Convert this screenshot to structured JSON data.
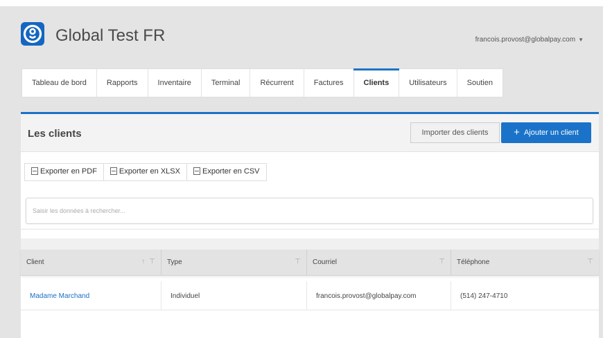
{
  "app": {
    "title": "Global Test FR",
    "user_email": "francois.provost@globalpay.com"
  },
  "colors": {
    "accent": "#1a73c8",
    "logo": "#1566c0",
    "link": "#1a6fc4"
  },
  "tabs": [
    {
      "label": "Tableau de bord"
    },
    {
      "label": "Rapports"
    },
    {
      "label": "Inventaire"
    },
    {
      "label": "Terminal"
    },
    {
      "label": "Récurrent"
    },
    {
      "label": "Factures"
    },
    {
      "label": "Clients",
      "active": true
    },
    {
      "label": "Utilisateurs"
    },
    {
      "label": "Soutien"
    }
  ],
  "panel": {
    "title": "Les clients",
    "import_label": "Importer des clients",
    "add_label": "Ajouter un client"
  },
  "export": {
    "pdf": "Exporter en PDF",
    "xlsx": "Exporter en XLSX",
    "csv": "Exporter en CSV",
    "icon": "spreadsheet-icon"
  },
  "search": {
    "placeholder": "Saisir les données à rechercher..."
  },
  "table": {
    "columns": [
      "Client",
      "Type",
      "Courriel",
      "Téléphone"
    ],
    "rows": [
      [
        "Madame Marchand",
        "Individuel",
        "francois.provost@globalpay.com",
        "(514) 247-4710"
      ]
    ]
  }
}
